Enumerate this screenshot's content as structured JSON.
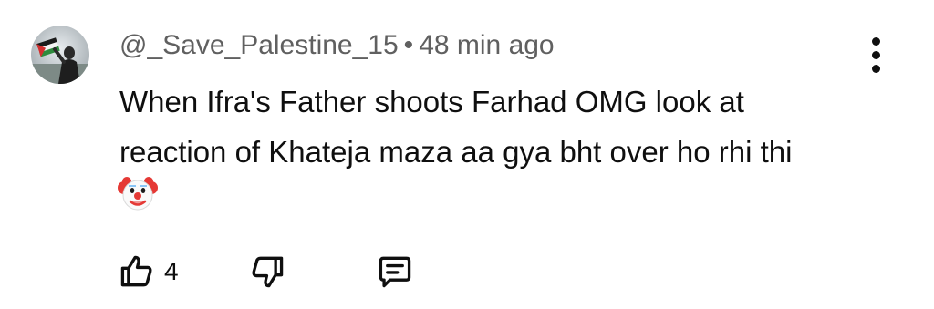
{
  "comment": {
    "author": "@_Save_Palestine_15",
    "separator": "•",
    "time_ago": "48 min ago",
    "text_lines": [
      "When Ifra's Father shoots Farhad OMG look at",
      "reaction of Khateja maza aa gya bht over ho rhi thi"
    ],
    "emoji": "clown-face-icon",
    "like_count": "4"
  },
  "icons": {
    "more": "kebab-menu-icon",
    "like": "thumbs-up-icon",
    "dislike": "thumbs-down-icon",
    "reply": "comment-reply-icon"
  },
  "colors": {
    "text": "#0f0f0f",
    "meta": "#606060",
    "background": "#ffffff"
  }
}
